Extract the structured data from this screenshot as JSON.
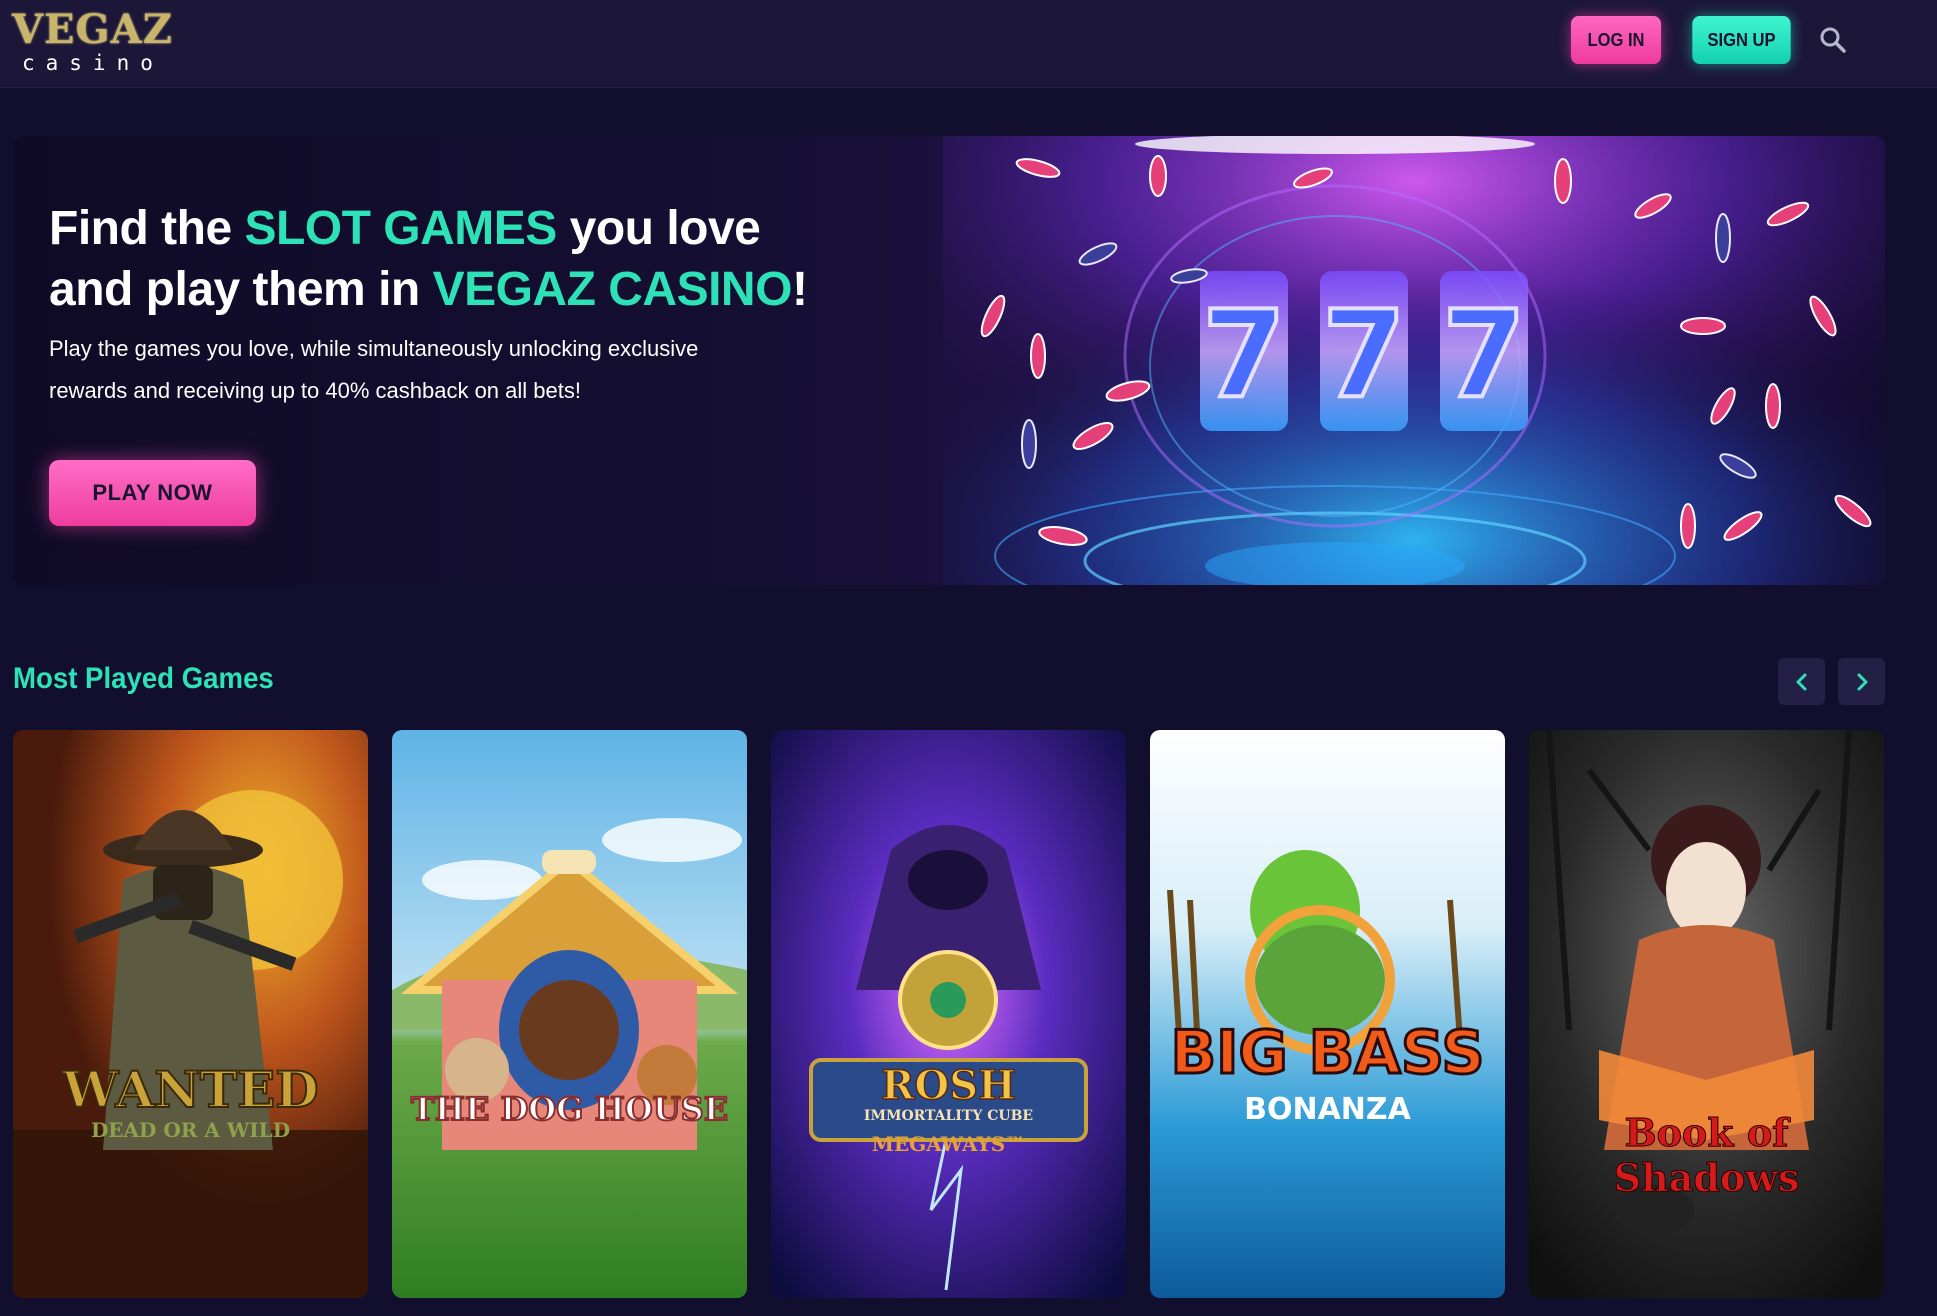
{
  "header": {
    "logo_main": "VEGAZ",
    "logo_sub": "casino",
    "login_label": "LOG IN",
    "signup_label": "SIGN UP",
    "search_icon": "search-icon"
  },
  "hero": {
    "title_part1": "Find the ",
    "title_accent1": "SLOT GAMES",
    "title_part2": " you love and play them in ",
    "title_accent2": "VEGAZ CASINO",
    "title_part3": "!",
    "description": "Play the games you love, while simultaneously unlocking exclusive rewards and receiving up to 40% cashback on all bets!",
    "cta_label": "PLAY NOW"
  },
  "most_played": {
    "title": "Most Played Games",
    "prev_icon": "chevron-left-icon",
    "next_icon": "chevron-right-icon",
    "games": [
      {
        "title": "WANTED",
        "subtitle": "DEAD OR A WILD"
      },
      {
        "title": "THE DOG HOUSE",
        "subtitle": ""
      },
      {
        "title": "ROSH",
        "subtitle": "IMMORTALITY CUBE",
        "tagline": "MEGAWAYS™"
      },
      {
        "title": "BIG BASS",
        "subtitle": "BONANZA"
      },
      {
        "title": "Book of Shadows",
        "subtitle": ""
      }
    ]
  },
  "colors": {
    "background": "#120e2e",
    "header": "#1c1739",
    "accent_teal": "#2de2b6",
    "accent_pink": "#ff5fb8"
  }
}
